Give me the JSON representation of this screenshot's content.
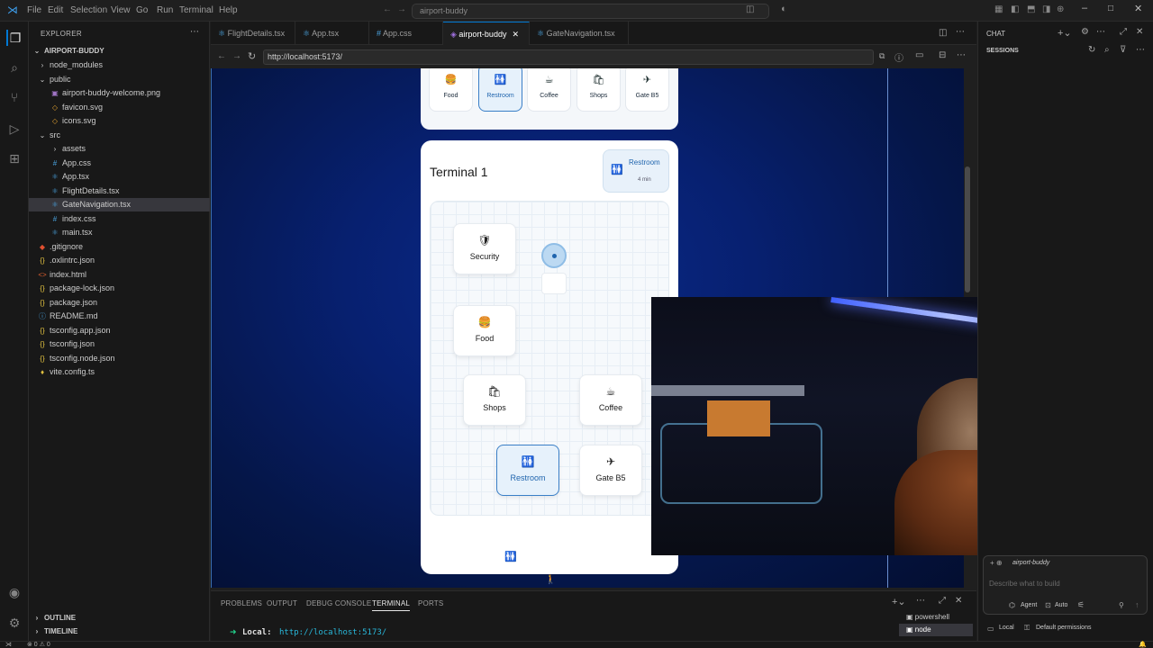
{
  "titlebar": {
    "menus": [
      "File",
      "Edit",
      "Selection",
      "View",
      "Go",
      "Run",
      "Terminal",
      "Help"
    ],
    "search": "airport-buddy"
  },
  "explorer": {
    "title": "EXPLORER",
    "root": "AIRPORT-BUDDY",
    "items": [
      {
        "label": "node_modules",
        "icon": "chevron-right-icon"
      },
      {
        "label": "public",
        "icon": "chevron-down-icon"
      },
      {
        "label": "airport-buddy-welcome.png",
        "icon": "image-file-icon"
      },
      {
        "label": "favicon.svg",
        "icon": "svg-file-icon"
      },
      {
        "label": "icons.svg",
        "icon": "svg-file-icon"
      },
      {
        "label": "src",
        "icon": "chevron-down-icon"
      },
      {
        "label": "assets",
        "icon": "chevron-right-icon"
      },
      {
        "label": "App.css",
        "icon": "css-file-icon"
      },
      {
        "label": "App.tsx",
        "icon": "tsx-file-icon"
      },
      {
        "label": "FlightDetails.tsx",
        "icon": "tsx-file-icon"
      },
      {
        "label": "GateNavigation.tsx",
        "icon": "tsx-file-icon"
      },
      {
        "label": "index.css",
        "icon": "css-file-icon"
      },
      {
        "label": "main.tsx",
        "icon": "tsx-file-icon"
      },
      {
        "label": ".gitignore",
        "icon": "git-file-icon"
      },
      {
        "label": ".oxlintrc.json",
        "icon": "json-file-icon"
      },
      {
        "label": "index.html",
        "icon": "html-file-icon"
      },
      {
        "label": "package-lock.json",
        "icon": "json-file-icon"
      },
      {
        "label": "package.json",
        "icon": "json-file-icon"
      },
      {
        "label": "README.md",
        "icon": "info-file-icon"
      },
      {
        "label": "tsconfig.app.json",
        "icon": "json-file-icon"
      },
      {
        "label": "tsconfig.json",
        "icon": "json-file-icon"
      },
      {
        "label": "tsconfig.node.json",
        "icon": "json-file-icon"
      },
      {
        "label": "vite.config.ts",
        "icon": "lightbulb-file-icon"
      }
    ],
    "outline": "OUTLINE",
    "timeline": "TIMELINE"
  },
  "tabs": [
    {
      "label": "FlightDetails.tsx"
    },
    {
      "label": "App.tsx"
    },
    {
      "label": "App.css"
    },
    {
      "label": "airport-buddy"
    },
    {
      "label": "GateNavigation.tsx"
    }
  ],
  "browser": {
    "url": "http://localhost:5173/"
  },
  "app": {
    "chips": [
      {
        "label": "Food",
        "glyph": "🍔"
      },
      {
        "label": "Restroom",
        "glyph": "🚻"
      },
      {
        "label": "Coffee",
        "glyph": "☕"
      },
      {
        "label": "Shops",
        "glyph": "🛍"
      },
      {
        "label": "Gate B5",
        "glyph": "✈"
      }
    ],
    "terminal_title": "Terminal 1",
    "destination": {
      "name": "Restroom",
      "time": "4 min",
      "glyph": "🚻"
    },
    "pois": {
      "security": {
        "label": "Security",
        "glyph": "🛡"
      },
      "food": {
        "label": "Food",
        "glyph": "🍔"
      },
      "shops": {
        "label": "Shops",
        "glyph": "🛍"
      },
      "coffee": {
        "label": "Coffee",
        "glyph": "☕"
      },
      "restroom": {
        "label": "Restroom",
        "glyph": "🚻"
      },
      "gate": {
        "label": "Gate B5",
        "glyph": "✈"
      }
    },
    "bottom_glyph": "🚻"
  },
  "panel": {
    "tabs": [
      "PROBLEMS",
      "OUTPUT",
      "DEBUG CONSOLE",
      "TERMINAL",
      "PORTS"
    ],
    "terminal_line_label": "Local:",
    "terminal_line_url": "http://localhost:5173/",
    "terminals": [
      "powershell",
      "node"
    ]
  },
  "chat": {
    "title": "CHAT",
    "sessions": "SESSIONS",
    "context": "airport-buddy",
    "placeholder": "Describe what to build",
    "agent": "Agent",
    "auto": "Auto",
    "local": "Local",
    "permissions": "Default permissions"
  },
  "statusbar": {
    "problems": "⊗ 0 ⚠ 0"
  }
}
